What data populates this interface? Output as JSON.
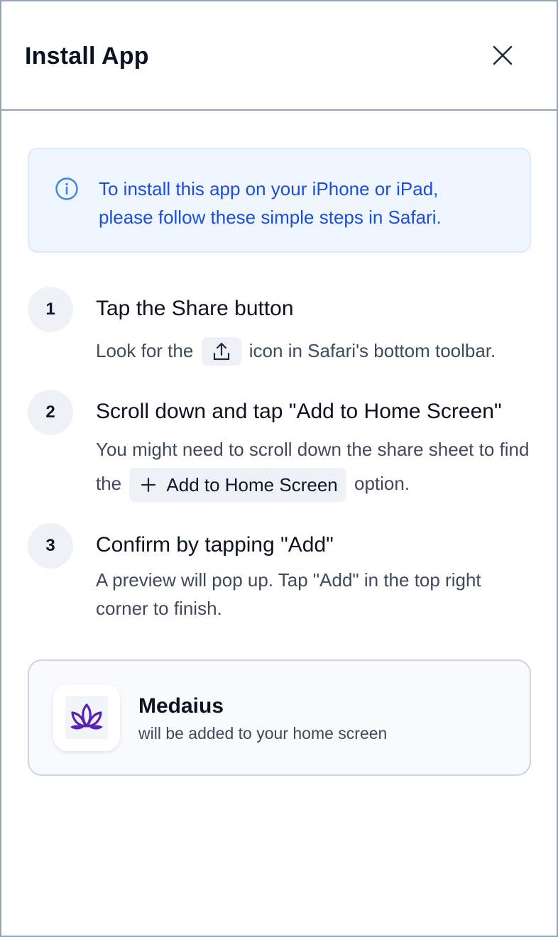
{
  "header": {
    "title": "Install App"
  },
  "info": {
    "line1": "To install this app on your iPhone or iPad,",
    "line2": "please follow these simple steps in Safari."
  },
  "steps": [
    {
      "number": "1",
      "title": "Tap the Share button",
      "desc_before": "Look for the",
      "desc_after": "icon in Safari's bottom toolbar."
    },
    {
      "number": "2",
      "title": "Scroll down and tap \"Add to Home Screen\"",
      "desc_before": "You might need to scroll down the share sheet to find the",
      "chip_label": "Add to Home Screen",
      "desc_after": "option."
    },
    {
      "number": "3",
      "title": "Confirm by tapping \"Add\"",
      "desc": "A preview will pop up. Tap \"Add\" in the top right corner to finish."
    }
  ],
  "preview": {
    "app_name": "Medaius",
    "subtitle": "will be added to your home screen"
  },
  "colors": {
    "accent": "#1d4ed8",
    "info_bg": "#eff6ff",
    "logo_purple": "#5b21b6"
  }
}
